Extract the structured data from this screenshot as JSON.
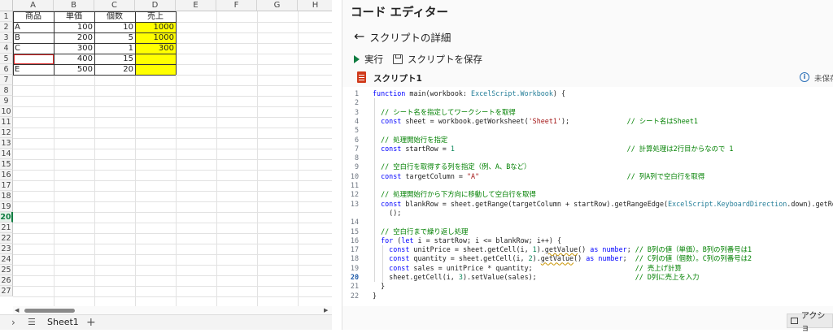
{
  "spreadsheet": {
    "columns": [
      "A",
      "B",
      "C",
      "D",
      "E",
      "F",
      "G",
      "H"
    ],
    "row_numbers": [
      "1",
      "2",
      "3",
      "4",
      "5",
      "6",
      "7",
      "8",
      "9",
      "10",
      "11",
      "12",
      "13",
      "14",
      "15",
      "16",
      "17",
      "18",
      "19",
      "20",
      "21",
      "22",
      "23",
      "24",
      "25",
      "26",
      "27"
    ],
    "selected_row": "20",
    "header_row": [
      "商品",
      "単価",
      "個数",
      "売上"
    ],
    "data_rows": [
      [
        "A",
        "100",
        "10",
        "1000"
      ],
      [
        "B",
        "200",
        "5",
        "1000"
      ],
      [
        "C",
        "300",
        "1",
        "300"
      ],
      [
        "",
        "400",
        "15",
        ""
      ],
      [
        "E",
        "500",
        "20",
        ""
      ]
    ],
    "sheet_tab": "Sheet1",
    "add_sheet": "+",
    "sheet_list_icon": "☰",
    "tab_nav_next": "›",
    "highlight_color": "#ffff00",
    "accent_color": "#107c41"
  },
  "editor": {
    "title": "コード エディター",
    "back_label": "スクリプトの詳細",
    "back_icon": "←",
    "run_label": "実行",
    "save_label": "スクリプトを保存",
    "script_name": "スクリプト1",
    "info_icon": "i",
    "unsaved_label": "未保存",
    "action_label": "アクショ",
    "current_line": "20",
    "code_lines": [
      {
        "n": "1",
        "t": "function main(workbook: ExcelScript.Workbook) {"
      },
      {
        "n": "2",
        "t": ""
      },
      {
        "n": "3",
        "t": "  // シート名を指定してワークシートを取得"
      },
      {
        "n": "4",
        "t": "  const sheet = workbook.getWorksheet('Sheet1');              // シート名はSheet1"
      },
      {
        "n": "5",
        "t": ""
      },
      {
        "n": "6",
        "t": "  // 処理開始行を指定"
      },
      {
        "n": "7",
        "t": "  const startRow = 1                                          // 計算処理は2行目からなので 1"
      },
      {
        "n": "8",
        "t": ""
      },
      {
        "n": "9",
        "t": "  // 空白行を取得する列を指定（例、A、Bなど）"
      },
      {
        "n": "10",
        "t": "  const targetColumn = \"A\"                                    // 列A列で空白行を取得"
      },
      {
        "n": "11",
        "t": ""
      },
      {
        "n": "12",
        "t": "  // 処理開始行から下方向に移動して空白行を取得"
      },
      {
        "n": "13",
        "t": "  const blankRow = sheet.getRange(targetColumn + startRow).getRangeEdge(ExcelScript.KeyboardDirection.down).getRowIndex"
      },
      {
        "n": "",
        "t": "    ();"
      },
      {
        "n": "14",
        "t": ""
      },
      {
        "n": "15",
        "t": "  // 空白行まで繰り返し処理"
      },
      {
        "n": "16",
        "t": "  for (let i = startRow; i <= blankRow; i++) {"
      },
      {
        "n": "17",
        "t": "    const unitPrice = sheet.getCell(i, 1).getValue() as number; // B列の値（単価）。B列の列番号は1"
      },
      {
        "n": "18",
        "t": "    const quantity = sheet.getCell(i, 2).getValue() as number;  // C列の値（個数）。C列の列番号は2"
      },
      {
        "n": "19",
        "t": "    const sales = unitPrice * quantity;                         // 売上げ計算"
      },
      {
        "n": "20",
        "t": "    sheet.getCell(i, 3).setValue(sales);                        // D列に売上を入力"
      },
      {
        "n": "21",
        "t": "  }"
      },
      {
        "n": "22",
        "t": "}"
      }
    ]
  }
}
